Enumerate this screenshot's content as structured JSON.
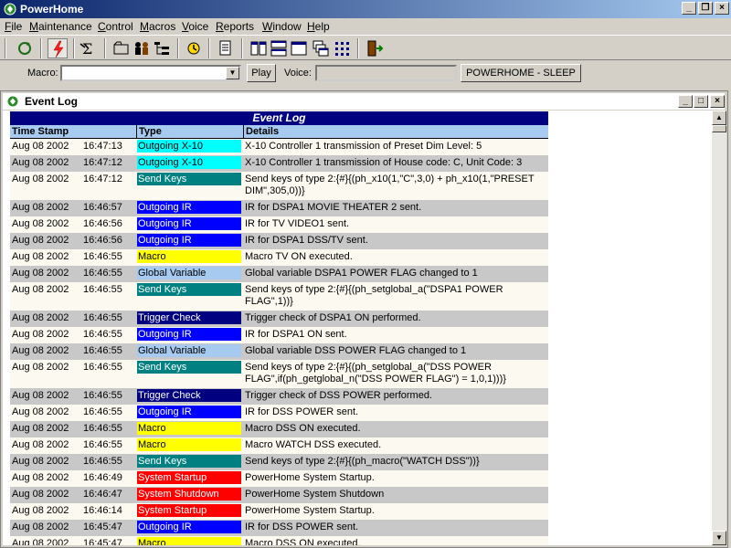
{
  "app": {
    "title": "PowerHome"
  },
  "menu": [
    "File",
    "Maintenance",
    "Control",
    "Macros",
    "Voice",
    "Reports",
    "Window",
    "Help"
  ],
  "macrobar": {
    "macro_label": "Macro:",
    "macro_value": "",
    "play_label": "Play",
    "voice_label": "Voice:",
    "voice_value": "",
    "status_label": "POWERHOME - SLEEP"
  },
  "child": {
    "title": "Event Log"
  },
  "log": {
    "title": "Event Log",
    "headers": {
      "timestamp": "Time Stamp",
      "type": "Type",
      "details": "Details"
    },
    "type_colors": {
      "Outgoing X-10": {
        "bg": "#00ffff",
        "fg": "#000000"
      },
      "Send Keys": {
        "bg": "#008080",
        "fg": "#ffffff"
      },
      "Outgoing IR": {
        "bg": "#0000ff",
        "fg": "#ffffff"
      },
      "Macro": {
        "bg": "#ffff00",
        "fg": "#000000"
      },
      "Global Variable": {
        "bg": "#a6caf0",
        "fg": "#000000"
      },
      "Trigger Check": {
        "bg": "#000080",
        "fg": "#ffffff"
      },
      "System Startup": {
        "bg": "#ff0000",
        "fg": "#ffffff"
      },
      "System Shutdown": {
        "bg": "#ff0000",
        "fg": "#ffffff"
      }
    },
    "rows": [
      {
        "date": "Aug  08  2002",
        "time": "16:47:13",
        "type": "Outgoing X-10",
        "details": "X-10 Controller 1 transmission of Preset Dim Level: 5"
      },
      {
        "date": "Aug  08  2002",
        "time": "16:47:12",
        "type": "Outgoing X-10",
        "details": "X-10 Controller 1 transmission of House code: C, Unit Code: 3"
      },
      {
        "date": "Aug  08  2002",
        "time": "16:47:12",
        "type": "Send Keys",
        "details": "Send keys of type 2:{#}{(ph_x10(1,\"C\",3,0) + ph_x10(1,\"PRESET DIM\",305,0))}"
      },
      {
        "date": "Aug  08  2002",
        "time": "16:46:57",
        "type": "Outgoing IR",
        "details": "IR for DSPA1 MOVIE THEATER 2 sent."
      },
      {
        "date": "Aug  08  2002",
        "time": "16:46:56",
        "type": "Outgoing IR",
        "details": "IR for TV VIDEO1 sent."
      },
      {
        "date": "Aug  08  2002",
        "time": "16:46:56",
        "type": "Outgoing IR",
        "details": "IR for DSPA1 DSS/TV sent."
      },
      {
        "date": "Aug  08  2002",
        "time": "16:46:55",
        "type": "Macro",
        "details": "Macro TV ON executed."
      },
      {
        "date": "Aug  08  2002",
        "time": "16:46:55",
        "type": "Global Variable",
        "details": "Global variable DSPA1 POWER FLAG changed to 1"
      },
      {
        "date": "Aug  08  2002",
        "time": "16:46:55",
        "type": "Send Keys",
        "details": "Send keys of type 2:{#}{(ph_setglobal_a(\"DSPA1 POWER FLAG\",1))}"
      },
      {
        "date": "Aug  08  2002",
        "time": "16:46:55",
        "type": "Trigger Check",
        "details": "Trigger check of DSPA1 ON performed."
      },
      {
        "date": "Aug  08  2002",
        "time": "16:46:55",
        "type": "Outgoing IR",
        "details": "IR for DSPA1 ON sent."
      },
      {
        "date": "Aug  08  2002",
        "time": "16:46:55",
        "type": "Global Variable",
        "details": "Global variable DSS POWER FLAG changed to 1"
      },
      {
        "date": "Aug  08  2002",
        "time": "16:46:55",
        "type": "Send Keys",
        "details": "Send keys of type 2:{#}{(ph_setglobal_a(\"DSS POWER FLAG\",if(ph_getglobal_n(\"DSS POWER FLAG\") = 1,0,1)))}"
      },
      {
        "date": "Aug  08  2002",
        "time": "16:46:55",
        "type": "Trigger Check",
        "details": "Trigger check of DSS POWER performed."
      },
      {
        "date": "Aug  08  2002",
        "time": "16:46:55",
        "type": "Outgoing IR",
        "details": "IR for DSS POWER sent."
      },
      {
        "date": "Aug  08  2002",
        "time": "16:46:55",
        "type": "Macro",
        "details": "Macro DSS ON executed."
      },
      {
        "date": "Aug  08  2002",
        "time": "16:46:55",
        "type": "Macro",
        "details": "Macro WATCH DSS executed."
      },
      {
        "date": "Aug  08  2002",
        "time": "16:46:55",
        "type": "Send Keys",
        "details": "Send keys of type 2:{#}{(ph_macro(\"WATCH DSS\"))}"
      },
      {
        "date": "Aug  08  2002",
        "time": "16:46:49",
        "type": "System Startup",
        "details": "PowerHome System Startup."
      },
      {
        "date": "Aug  08  2002",
        "time": "16:46:47",
        "type": "System Shutdown",
        "details": "PowerHome System Shutdown"
      },
      {
        "date": "Aug  08  2002",
        "time": "16:46:14",
        "type": "System Startup",
        "details": "PowerHome System Startup."
      },
      {
        "date": "Aug  08  2002",
        "time": "16:45:47",
        "type": "Outgoing IR",
        "details": "IR for DSS POWER sent."
      },
      {
        "date": "Aug  08  2002",
        "time": "16:45:47",
        "type": "Macro",
        "details": "Macro DSS ON executed."
      }
    ]
  }
}
